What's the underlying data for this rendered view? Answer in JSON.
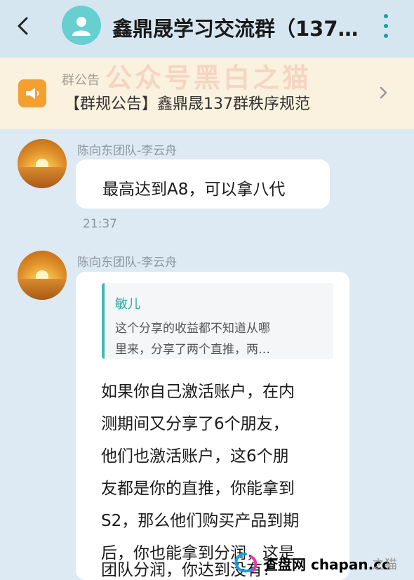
{
  "header": {
    "title": "鑫鼎晟学习交流群（137…",
    "back_icon": "back-arrow-icon",
    "more_icon": "more-vertical-icon",
    "avatar_icon": "group-avatar-icon"
  },
  "notice": {
    "label": "群公告",
    "text": "【群规公告】鑫鼎晟137群秩序规范",
    "icon": "megaphone-icon"
  },
  "watermark": {
    "text": "公众号黑白之猫"
  },
  "messages": [
    {
      "sender": "陈向东团队-李云舟",
      "text": "最高达到A8，可以拿八代",
      "time": "21:37"
    },
    {
      "sender": "陈向东团队-李云舟",
      "quote": {
        "author": "敏儿",
        "line1": "这个分享的收益都不知道从哪",
        "line2": "里来，分享了两个直推，两…"
      },
      "lines": [
        "如果你自己激活账户，在内",
        "测期间又分享了6个朋友，",
        "他们也激活账户，这6个朋",
        "友都是你的直推，你能拿到",
        "S2，那么他们购买产品到期",
        "后，你也能拿到分润，这是",
        "团队分润，你达到没有?"
      ]
    }
  ],
  "site_watermark": {
    "text": "查盘网 chapan.cc",
    "tail": "之猫"
  },
  "colors": {
    "accent": "#14a3a8",
    "notice_bg": "#fbf1df",
    "chat_bg": "#dde9f3",
    "notice_icon": "#f4a030"
  }
}
